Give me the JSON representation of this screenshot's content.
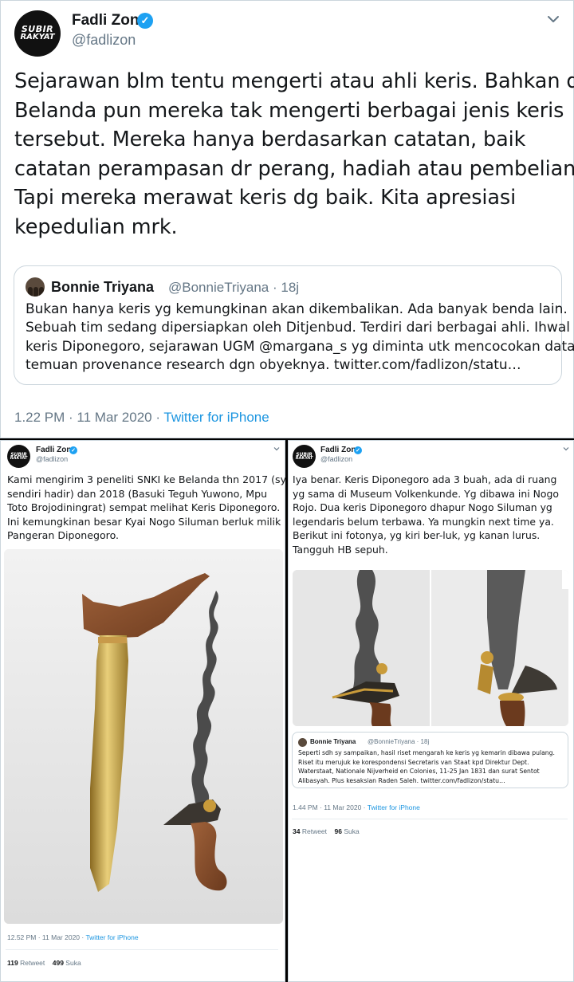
{
  "main_tweet": {
    "avatar_text": [
      "SUBIR",
      "RAKYAT"
    ],
    "author_name": "Fadli Zon",
    "author_handle": "@fadlizon",
    "text_lines": [
      "Sejarawan blm tentu mengerti atau ahli keris. Bahkan di",
      "Belanda pun mereka tak mengerti berbagai jenis keris",
      "tersebut. Mereka hanya berdasarkan catatan, baik",
      "catatan perampasan dr perang, hadiah atau pembelian.",
      "Tapi mereka merawat keris dg baik. Kita apresiasi",
      "kepedulian mrk."
    ],
    "quoted": {
      "author_name": "Bonnie Triyana",
      "author_handle": "@BonnieTriyana",
      "age": "· 18j",
      "text_lines": [
        "Bukan hanya keris yg kemungkinan akan dikembalikan. Ada banyak benda lain.",
        "Sebuah tim sedang dipersiapkan oleh Ditjenbud. Terdiri dari berbagai ahli. Ihwal",
        "keris Diponegoro, sejarawan UGM @margana_s yg diminta utk mencocokan data",
        "temuan provenance research dgn obyeknya. twitter.com/fadlizon/statu…"
      ]
    },
    "timestamp": "1.22 PM · 11 Mar 2020 · ",
    "source": "Twitter for iPhone"
  },
  "left_tweet": {
    "author_name": "Fadli Zon",
    "author_handle": "@fadlizon",
    "text_lines": [
      "Kami mengirim 3 peneliti SNKI ke Belanda thn 2017 (sy",
      "sendiri hadir) dan 2018 (Basuki Teguh Yuwono, Mpu",
      "Toto Brojodiningrat) sempat melihat Keris Diponegoro.",
      "Ini kemungkinan besar Kyai Nogo Siluman berluk milik",
      "Pangeran Diponegoro."
    ],
    "timestamp": "12.52 PM · 11 Mar 2020 · ",
    "source": "Twitter for iPhone",
    "retweets": "119",
    "retweets_label": "Retweet",
    "likes": "499",
    "likes_label": "Suka"
  },
  "right_tweet": {
    "author_name": "Fadli Zon",
    "author_handle": "@fadlizon",
    "text_lines": [
      "Iya benar. Keris Diponegoro ada 3 buah, ada di ruang",
      "yg sama di Museum Volkenkunde. Yg dibawa ini Nogo",
      "Rojo. Dua keris Diponegoro dhapur Nogo Siluman yg",
      "legendaris belum terbawa. Ya mungkin next time ya.",
      "Berikut ini fotonya, yg kiri ber-luk, yg kanan lurus.",
      "Tangguh HB sepuh."
    ],
    "quoted": {
      "author_name": "Bonnie Triyana",
      "author_handle": "@BonnieTriyana",
      "age": "· 18j",
      "text_lines": [
        "Seperti sdh sy sampaikan, hasil riset mengarah ke keris yg kemarin dibawa pulang.",
        "Riset itu merujuk ke korespondensi Secretaris van Staat kpd Direktur Dept.",
        "Waterstaat, Nationale Nijverheid en Colonies, 11-25 Jan 1831 dan surat Sentot",
        "Alibasyah. Plus kesaksian Raden Saleh. twitter.com/fadlizon/statu…"
      ]
    },
    "timestamp": "1.44 PM · 11 Mar 2020 · ",
    "source": "Twitter for iPhone",
    "retweets": "34",
    "retweets_label": "Retweet",
    "likes": "96",
    "likes_label": "Suka"
  },
  "colors": {
    "link": "#1b95e0",
    "verified": "#1da1f2",
    "muted": "#657786",
    "border": "#ccd6dd"
  },
  "icons": [
    "verified-badge-icon",
    "chevron-down-icon"
  ]
}
